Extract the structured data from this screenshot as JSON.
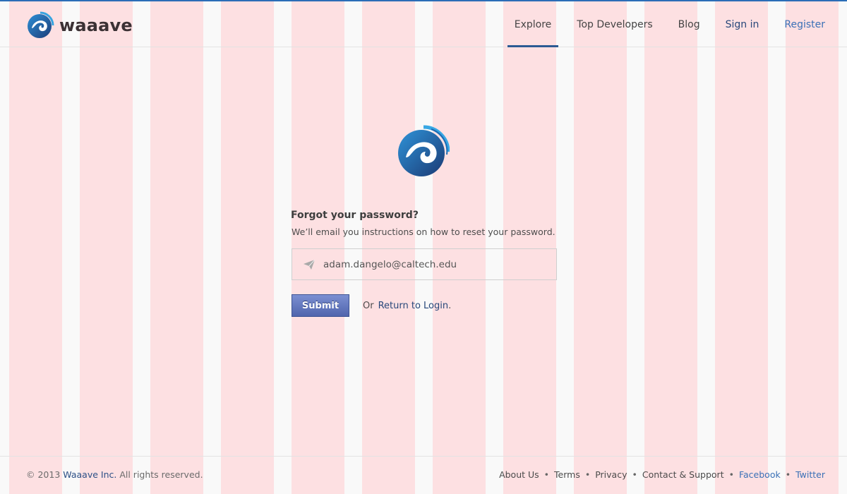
{
  "colors": {
    "accent": "#2b6db7",
    "link": "#27477a",
    "register": "#3a70b6",
    "submit_bg": "#5a6fb6",
    "grid_overlay": "#fde0e2"
  },
  "brand": {
    "name": "waaave",
    "logo_icon": "wave-logo-icon"
  },
  "nav": {
    "items": [
      {
        "label": "Explore",
        "active": true
      },
      {
        "label": "Top Developers",
        "active": false
      },
      {
        "label": "Blog",
        "active": false
      },
      {
        "label": "Sign in",
        "active": false
      },
      {
        "label": "Register",
        "active": false
      }
    ]
  },
  "form": {
    "title": "Forgot your password?",
    "subtitle": "We’ll email you instructions on how to reset your password.",
    "email_icon": "paper-plane-icon",
    "email_value": "adam.dangelo@caltech.edu",
    "submit_label": "Submit",
    "or_text": "Or",
    "return_link": "Return to Login",
    "return_suffix": "."
  },
  "footer": {
    "copyright_prefix": "© 2013",
    "company": "Waaave Inc.",
    "rights": "All rights reserved.",
    "separator": "•",
    "links": [
      "About Us",
      "Terms",
      "Privacy",
      "Contact & Support",
      "Facebook",
      "Twitter"
    ]
  }
}
